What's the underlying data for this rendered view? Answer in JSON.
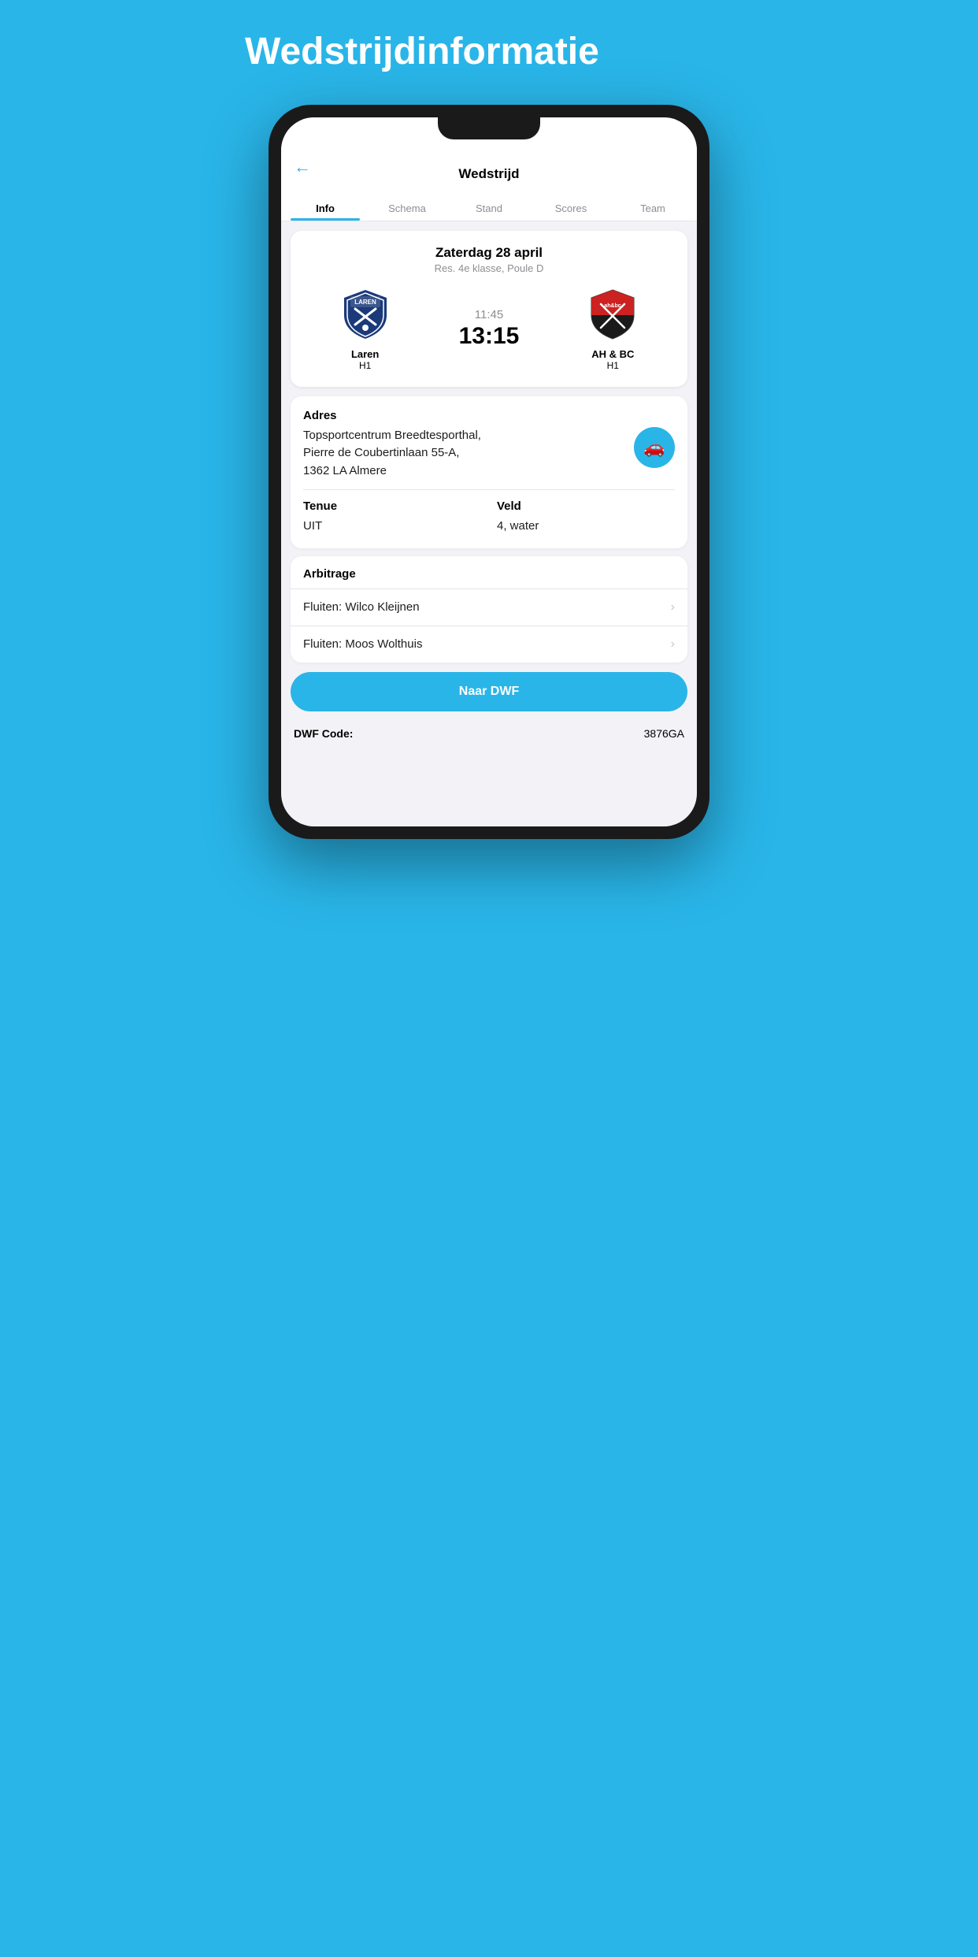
{
  "page": {
    "background_title": "Wedstrijdinformatie",
    "accent_color": "#29b5e8"
  },
  "header": {
    "back_label": "←",
    "title": "Wedstrijd"
  },
  "tabs": [
    {
      "label": "Info",
      "active": true
    },
    {
      "label": "Schema",
      "active": false
    },
    {
      "label": "Stand",
      "active": false
    },
    {
      "label": "Scores",
      "active": false
    },
    {
      "label": "Team",
      "active": false
    }
  ],
  "match": {
    "date": "Zaterdag 28 april",
    "subtitle": "Res. 4e klasse, Poule D",
    "time_scheduled": "11:45",
    "time_kickoff": "13:15",
    "home_team": {
      "name": "Laren",
      "sub": "H1"
    },
    "away_team": {
      "name": "AH & BC",
      "sub": "H1"
    }
  },
  "address": {
    "label": "Adres",
    "value": "Topsportcentrum Breedtesporthal,\nPierre de Coubertinlaan 55-A,\n1362 LA Almere",
    "map_icon": "🚗"
  },
  "tenue": {
    "label": "Tenue",
    "value": "UIT"
  },
  "veld": {
    "label": "Veld",
    "value": "4, water"
  },
  "arbitrage": {
    "label": "Arbitrage",
    "items": [
      {
        "text": "Fluiten: Wilco Kleijnen"
      },
      {
        "text": "Fluiten: Moos Wolthuis"
      }
    ]
  },
  "dwf_button": {
    "label": "Naar DWF"
  },
  "dwf_code": {
    "label": "DWF Code:",
    "value": "3876GA"
  }
}
